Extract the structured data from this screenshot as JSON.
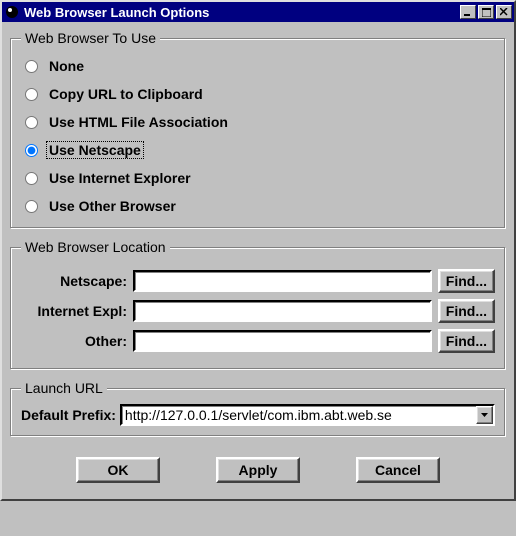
{
  "window": {
    "title": "Web Browser Launch Options"
  },
  "group_use": {
    "legend": "Web Browser To Use",
    "options": {
      "none": "None",
      "copy": "Copy URL to Clipboard",
      "html": "Use HTML File Association",
      "netscape": "Use Netscape",
      "ie": "Use Internet Explorer",
      "other": "Use Other Browser"
    },
    "selected": "netscape"
  },
  "group_loc": {
    "legend": "Web Browser Location",
    "rows": {
      "netscape": {
        "label": "Netscape:",
        "value": ""
      },
      "ie": {
        "label": "Internet Expl:",
        "value": ""
      },
      "other": {
        "label": "Other:",
        "value": ""
      }
    },
    "find_label": "Find..."
  },
  "group_launch": {
    "legend": "Launch URL",
    "prefix_label": "Default Prefix:",
    "prefix_value": "http://127.0.0.1/servlet/com.ibm.abt.web.se"
  },
  "buttons": {
    "ok": "OK",
    "apply": "Apply",
    "cancel": "Cancel"
  }
}
